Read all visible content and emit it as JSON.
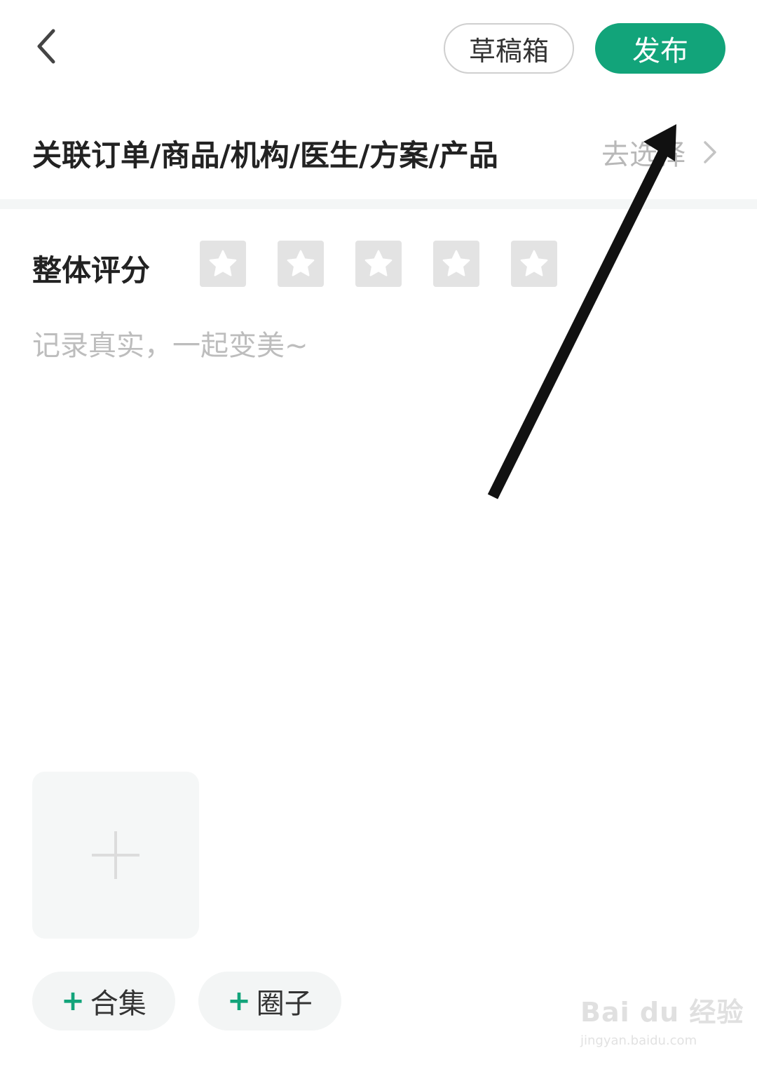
{
  "header": {
    "back_icon": "chevron-left-icon",
    "draft_label": "草稿箱",
    "publish_label": "发布",
    "accent_color": "#12a47a"
  },
  "link_section": {
    "title": "关联订单/商品/机构/医生/方案/产品",
    "action_label": "去选择",
    "action_icon": "chevron-right-icon"
  },
  "rating": {
    "label": "整体评分",
    "max_stars": 5,
    "selected": 0
  },
  "content": {
    "placeholder": "记录真实，一起变美~",
    "value": ""
  },
  "media": {
    "add_icon": "plus-icon"
  },
  "tags": [
    {
      "label": "合集"
    },
    {
      "label": "圈子"
    }
  ],
  "watermark": {
    "logo": "Bai du 经验",
    "url": "jingyan.baidu.com"
  }
}
